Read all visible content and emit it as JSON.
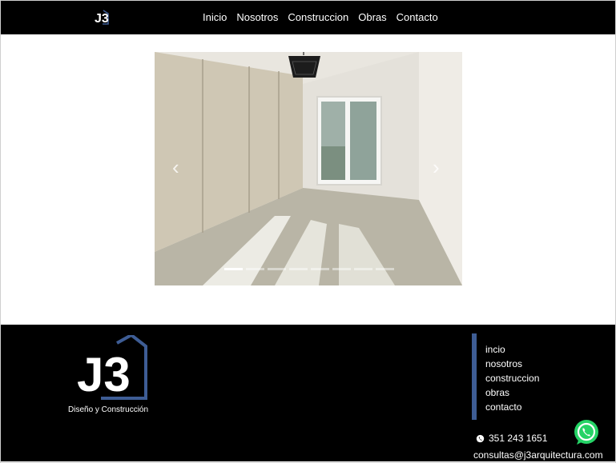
{
  "header": {
    "logo_text": "J3",
    "nav": [
      {
        "label": "Inicio"
      },
      {
        "label": "Nosotros"
      },
      {
        "label": "Construccion"
      },
      {
        "label": "Obras"
      },
      {
        "label": "Contacto"
      }
    ]
  },
  "carousel": {
    "prev_glyph": "‹",
    "next_glyph": "›",
    "slide_count": 8,
    "active_index": 0
  },
  "footer": {
    "brand": "J3",
    "brand_subtitle": "Diseño y Construcción",
    "links": [
      {
        "label": "incio"
      },
      {
        "label": "nosotros"
      },
      {
        "label": "construccion"
      },
      {
        "label": "obras"
      },
      {
        "label": "contacto"
      }
    ],
    "phone": "351 243 1651",
    "email": "consultas@j3arquitectura.com"
  },
  "colors": {
    "header_bg": "#000000",
    "footer_bg": "#000000",
    "accent_blue": "#3e5d95",
    "whatsapp_green": "#25d366"
  },
  "icons": [
    "j3-logo-icon",
    "chevron-left-icon",
    "chevron-right-icon",
    "whatsapp-icon"
  ]
}
